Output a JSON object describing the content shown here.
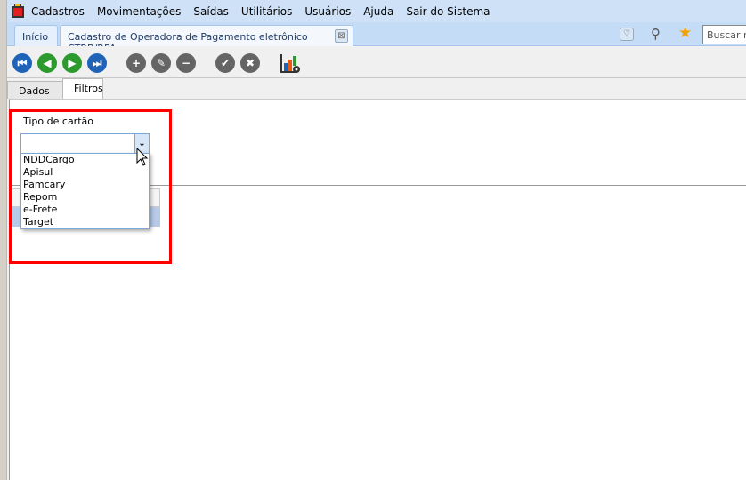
{
  "menu": {
    "items": [
      "Cadastros",
      "Movimentações",
      "Saídas",
      "Utilitários",
      "Usuários",
      "Ajuda",
      "Sair do Sistema"
    ]
  },
  "tabs": {
    "home": "Início",
    "active": "Cadastro de Operadora de Pagamento eletrônico CTRB/RPA",
    "close": "⊠"
  },
  "search": {
    "placeholder": "Buscar na p"
  },
  "subtabs": [
    "Dados",
    "Filtros"
  ],
  "filter": {
    "label": "Tipo de cartão",
    "value": "",
    "options": [
      "NDDCargo",
      "Apisul",
      "Pamcary",
      "Repom",
      "e-Frete",
      "Target"
    ]
  },
  "colors": {
    "highlight": "#ff0000",
    "nav_blue": "#1f63b8",
    "nav_green": "#2d9a2d",
    "action_gray": "#656565"
  }
}
